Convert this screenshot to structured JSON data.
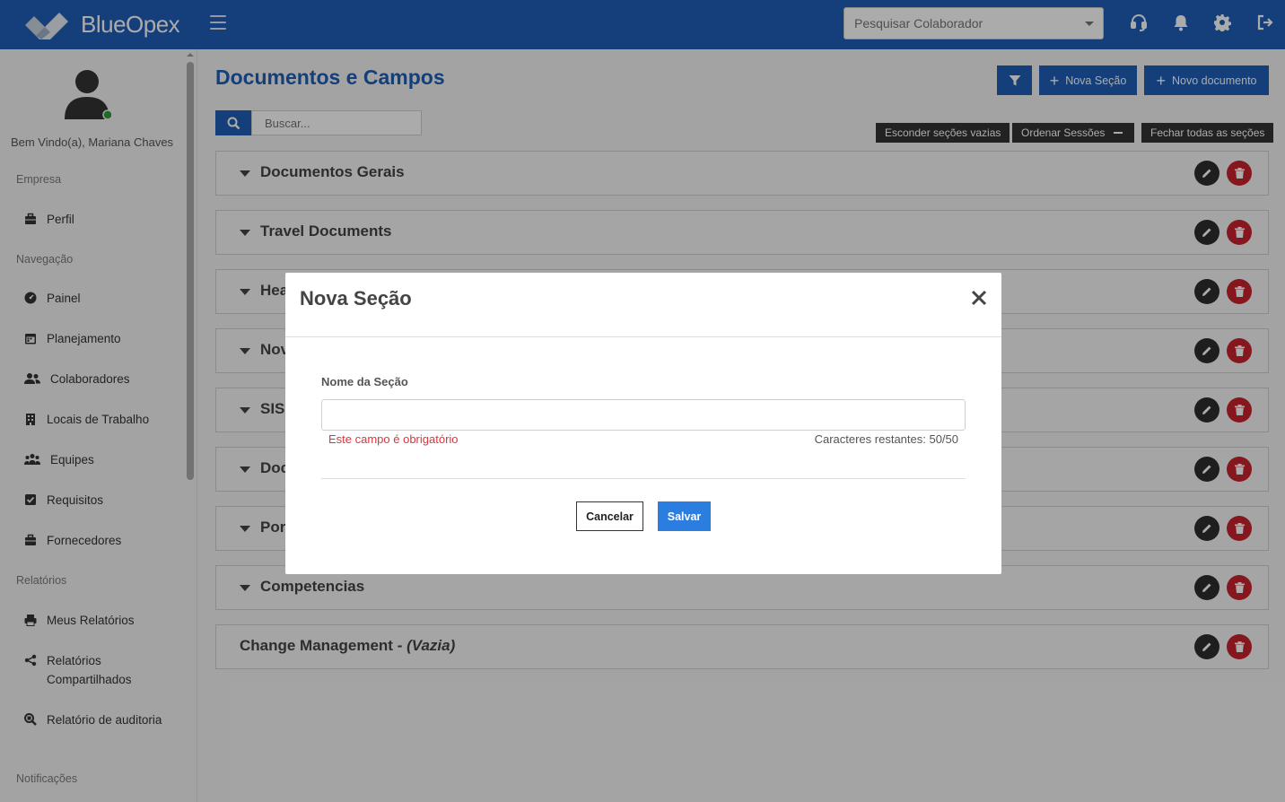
{
  "header": {
    "logo_text": "BlueOpex",
    "search_placeholder": "Pesquisar Colaborador",
    "icons": [
      "menu-icon",
      "headset-icon",
      "bell-icon",
      "gear-icon",
      "logout-icon"
    ]
  },
  "sidebar": {
    "welcome": "Bem Vindo(a), Mariana Chaves",
    "online_status_color": "#2e9e3e",
    "groups": {
      "empresa": "Empresa",
      "navegacao": "Navegação",
      "relatorios": "Relatórios",
      "notificacoes": "Notificações"
    },
    "items": {
      "perfil": "Perfil",
      "painel": "Painel",
      "planejamento": "Planejamento",
      "colaboradores": "Colaboradores",
      "locais": "Locais de Trabalho",
      "equipes": "Equipes",
      "requisitos": "Requisitos",
      "fornecedores": "Fornecedores",
      "meus_relatorios": "Meus Relatórios",
      "relatorios_compartilhados": "Relatórios Compartilhados",
      "relatorio_auditoria": "Relatório de auditoria"
    }
  },
  "main": {
    "title": "Documentos e Campos",
    "nova_secao": "Nova Seção",
    "novo_documento": "Novo documento",
    "search_placeholder": "Buscar...",
    "esconder": "Esconder seções vazias",
    "ordenar": "Ordenar Sessões",
    "fechar": "Fechar todas as seções",
    "sections": [
      {
        "title": "Documentos Gerais"
      },
      {
        "title": "Travel Documents"
      },
      {
        "title": "Hea"
      },
      {
        "title": "Nov"
      },
      {
        "title": "SISI"
      },
      {
        "title": "Doc"
      },
      {
        "title": "Por"
      },
      {
        "title": "Competencias"
      },
      {
        "title": "Change Management",
        "suffix": "- (Vazia)"
      }
    ]
  },
  "modal": {
    "title": "Nova Seção",
    "field_label": "Nome da Seção",
    "field_value": "",
    "error": "Este campo é obrigatório",
    "remaining": "Caracteres restantes: 50/50",
    "cancel": "Cancelar",
    "save": "Salvar"
  },
  "colors": {
    "brand": "#1f5fb6",
    "danger": "#c8232f",
    "save": "#2c7de0"
  }
}
